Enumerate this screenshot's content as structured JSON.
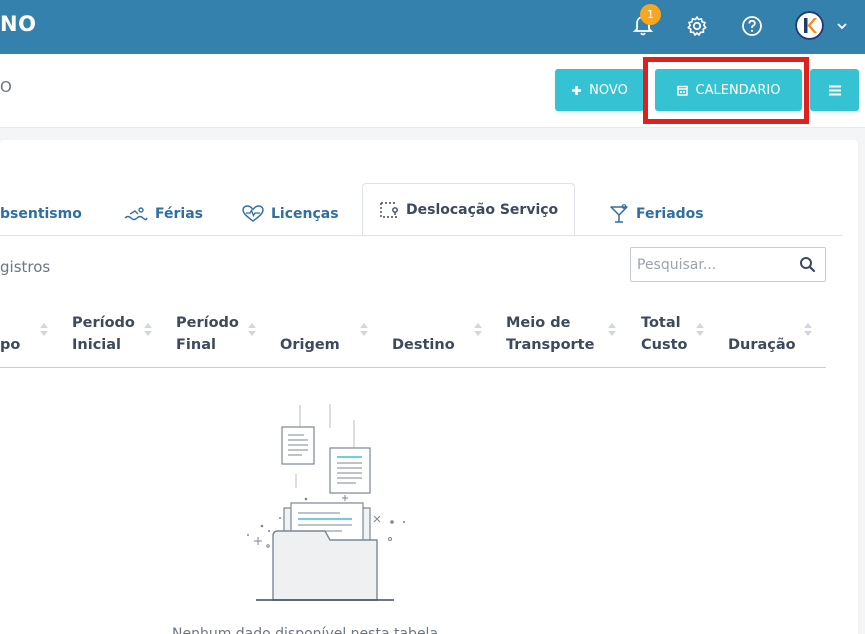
{
  "header": {
    "brand_partial": "NO",
    "notifications_count": "1",
    "avatar_letter": "K"
  },
  "subheader": {
    "title_partial": "O"
  },
  "toolbar": {
    "novo_label": "NOVO",
    "calendario_label": "CALENDARIO"
  },
  "tabs": [
    {
      "label": "bsentismo",
      "icon": "absence-icon"
    },
    {
      "label": "Férias",
      "icon": "swimmer-icon"
    },
    {
      "label": "Licenças",
      "icon": "heartbeat-icon"
    },
    {
      "label": "Deslocação Serviço",
      "icon": "route-icon",
      "active": true
    },
    {
      "label": "Feriados",
      "icon": "cocktail-icon"
    }
  ],
  "table": {
    "records_partial": "gistros",
    "search_placeholder": "Pesquisar...",
    "columns": [
      "po",
      "Período Inicial",
      "Período Final",
      "Origem",
      "Destino",
      "Meio de Transporte",
      "Total Custo",
      "Duração"
    ],
    "rows": []
  },
  "empty_state": {
    "text_partial": "Nenhum dado disponível nesta tabela"
  },
  "colors": {
    "topbar": "#3581ad",
    "accent_button": "#35c3d4",
    "highlight_box": "#e0201f",
    "badge": "#f5a623"
  }
}
